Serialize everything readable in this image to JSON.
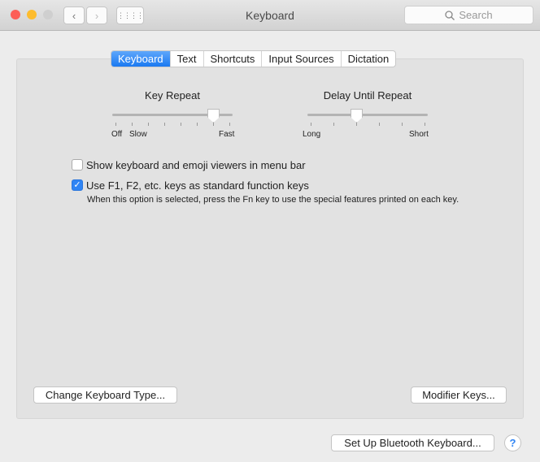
{
  "window": {
    "title": "Keyboard",
    "search_placeholder": "Search"
  },
  "tabs": [
    "Keyboard",
    "Text",
    "Shortcuts",
    "Input Sources",
    "Dictation"
  ],
  "active_tab": "Keyboard",
  "key_repeat": {
    "label": "Key Repeat",
    "min_label": "Off",
    "slow_label": "Slow",
    "max_label": "Fast",
    "ticks": 8,
    "value": 0.857
  },
  "delay_until_repeat": {
    "label": "Delay Until Repeat",
    "min_label": "Long",
    "max_label": "Short",
    "ticks": 6,
    "value": 0.4
  },
  "options": {
    "show_viewers": {
      "label": "Show keyboard and emoji viewers in menu bar",
      "checked": false
    },
    "fn_keys": {
      "label": "Use F1, F2, etc. keys as standard function keys",
      "checked": true,
      "note": "When this option is selected, press the Fn key to use the special features printed on each key."
    }
  },
  "buttons": {
    "change_type": "Change Keyboard Type...",
    "modifier": "Modifier Keys...",
    "bluetooth": "Set Up Bluetooth Keyboard...",
    "help": "?"
  },
  "colors": {
    "accent": "#1a79f1"
  }
}
